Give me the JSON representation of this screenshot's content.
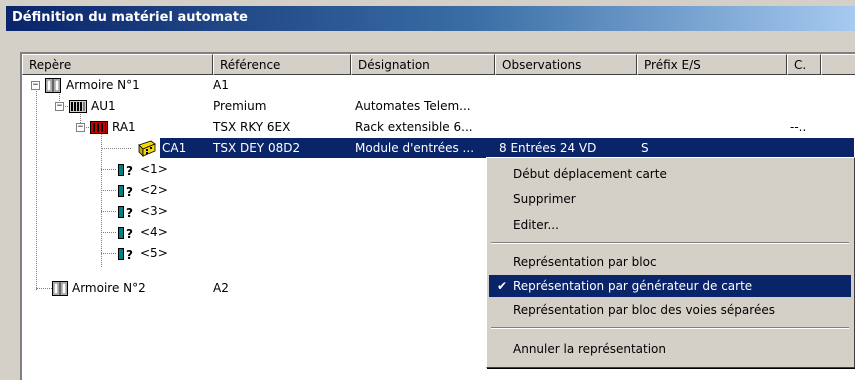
{
  "window": {
    "title": "Définition du matériel automate"
  },
  "columns": [
    "Repère",
    "Référence",
    "Désignation",
    "Observations",
    "Préfix E/S",
    "C."
  ],
  "rows": [
    {
      "label": "Armoire N°1",
      "reference": "A1",
      "designation": "",
      "observations": "",
      "prefix": "",
      "c": "",
      "icon": "cabinet-icon",
      "expander": "−"
    },
    {
      "label": "AU1",
      "reference": "Premium",
      "designation": "Automates Telem...",
      "observations": "",
      "prefix": "",
      "c": "",
      "icon": "plc-icon",
      "expander": "−"
    },
    {
      "label": "RA1",
      "reference": "TSX RKY 6EX",
      "designation": "Rack extensible 6...",
      "observations": "",
      "prefix": "",
      "c": "--..",
      "icon": "rack-icon",
      "expander": "−"
    },
    {
      "label": "CA1",
      "reference": "TSX DEY 08D2",
      "designation": "Module d'entrées ...",
      "observations": "8 Entrées   24 VD",
      "prefix": "S",
      "c": "",
      "icon": "input-module-icon",
      "selected": true
    },
    {
      "label": "<1>",
      "icon": "empty-slot-icon"
    },
    {
      "label": "<2>",
      "icon": "empty-slot-icon"
    },
    {
      "label": "<3>",
      "icon": "empty-slot-icon"
    },
    {
      "label": "<4>",
      "icon": "empty-slot-icon"
    },
    {
      "label": "<5>",
      "icon": "empty-slot-icon"
    },
    {
      "label": "Armoire N°2",
      "reference": "A2",
      "designation": "",
      "observations": "",
      "prefix": "",
      "c": "",
      "icon": "cabinet-icon"
    }
  ],
  "context_menu": {
    "items": [
      {
        "label": "Début déplacement carte"
      },
      {
        "label": "Supprimer"
      },
      {
        "label": "Editer..."
      },
      {
        "separator": true
      },
      {
        "label": "Représentation par bloc"
      },
      {
        "label": "Représentation par générateur de carte",
        "checked": true,
        "highlighted": true
      },
      {
        "label": "Représentation par bloc des voies séparées"
      },
      {
        "separator": true
      },
      {
        "label": "Annuler la représentation"
      }
    ],
    "check_glyph": "✔"
  },
  "colors": {
    "selection": "#0a246a",
    "face": "#d4d0c8",
    "rack_red": "#cc0000",
    "module_yellow": "#f5d800",
    "slot_teal": "#008080"
  }
}
